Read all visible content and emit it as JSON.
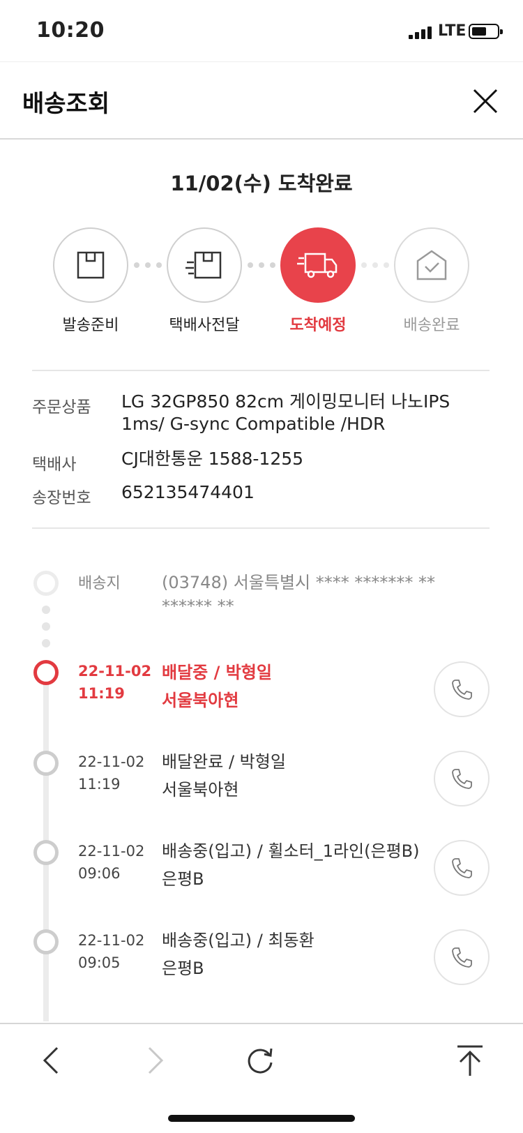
{
  "status_bar": {
    "time": "10:20",
    "network": "LTE"
  },
  "header": {
    "title": "배송조회"
  },
  "summary": {
    "arrival_title": "11/02(수) 도착완료"
  },
  "steps": [
    {
      "label": "발송준비",
      "icon": "box-icon",
      "state": "done"
    },
    {
      "label": "택배사전달",
      "icon": "fast-box-icon",
      "state": "done"
    },
    {
      "label": "도착예정",
      "icon": "truck-icon",
      "state": "current"
    },
    {
      "label": "배송완료",
      "icon": "house-check-icon",
      "state": "pending"
    }
  ],
  "info": {
    "product_label": "주문상품",
    "product_line1": "LG 32GP850 82cm 게이밍모니터 나노IPS",
    "product_line2": "1ms/ G-sync Compatible /HDR",
    "courier_label": "택배사",
    "courier_value": "CJ대한통운 1588-1255",
    "invoice_label": "송장번호",
    "invoice_value": "652135474401"
  },
  "timeline": {
    "origin_label": "배송지",
    "origin_line1": "(03748) 서울특별시 **** ******* **",
    "origin_line2": "****** **",
    "events": [
      {
        "date": "22-11-02",
        "time": "11:19",
        "line1": "배달중 / 박형일",
        "line2": "서울북아현",
        "active": true
      },
      {
        "date": "22-11-02",
        "time": "11:19",
        "line1": "배달완료 / 박형일",
        "line2": "서울북아현",
        "active": false
      },
      {
        "date": "22-11-02",
        "time": "09:06",
        "line1": "배송중(입고) / 휠소터_1라인(은평B)",
        "line2": "은평B",
        "active": false
      },
      {
        "date": "22-11-02",
        "time": "09:05",
        "line1": "배송중(입고) / 최동환",
        "line2": "은평B",
        "active": false
      }
    ]
  },
  "colors": {
    "accent": "#e23a40",
    "muted": "#9a9a9a"
  }
}
